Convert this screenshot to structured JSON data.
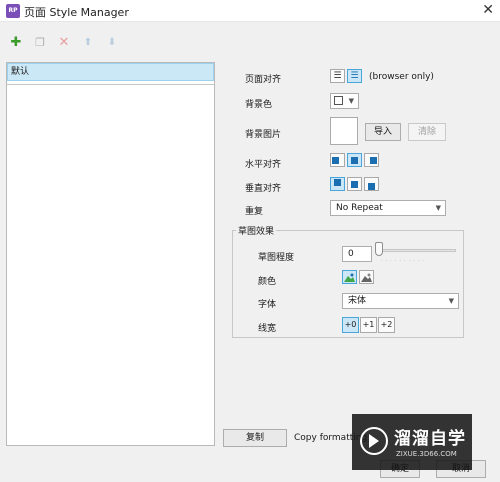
{
  "window": {
    "title": "页面 Style Manager",
    "app_icon_text": "RP",
    "close_glyph": "✕"
  },
  "toolbar": {
    "add_glyph": "✚",
    "duplicate_glyph": "❐",
    "delete_glyph": "✕",
    "move_up_glyph": "⬆",
    "move_down_glyph": "⬇"
  },
  "styles_list": {
    "items": [
      {
        "label": "默认",
        "selected": true
      }
    ]
  },
  "properties": {
    "page_align": {
      "label": "页面对齐",
      "options": [
        "left-align-icon",
        "center-align-icon"
      ],
      "selected_index": 1,
      "note": "(browser only)"
    },
    "background_color": {
      "label": "背景色",
      "value": "#ffffff"
    },
    "background_image": {
      "label": "背景图片",
      "import_label": "导入",
      "clear_label": "清除"
    },
    "horizontal_align": {
      "label": "水平对齐",
      "selected_index": 1
    },
    "vertical_align": {
      "label": "垂直对齐",
      "selected_index": 0
    },
    "repeat": {
      "label": "重复",
      "value": "No Repeat"
    }
  },
  "sketch_effects": {
    "title": "草图效果",
    "sketchiness": {
      "label": "草图程度",
      "value": "0"
    },
    "color": {
      "label": "颜色",
      "options": [
        "color-image-icon",
        "grayscale-image-icon"
      ],
      "selected_index": 0
    },
    "font": {
      "label": "字体",
      "value": "宋体"
    },
    "line_width": {
      "label": "线宽",
      "options": [
        "+0",
        "+1",
        "+2"
      ],
      "selected_index": 0
    }
  },
  "footer": {
    "copy_label": "复制",
    "copy_desc": "Copy formatting",
    "ok_label": "确定",
    "cancel_label": "取消"
  },
  "watermark": {
    "title": "溜溜自学",
    "subtitle": "ZIXUE.3D66.COM"
  },
  "colors": {
    "accent": "#1b6fb0",
    "selection": "#cbe8f6",
    "add_green": "#3a9a2a",
    "delete_red": "#d9534f"
  }
}
